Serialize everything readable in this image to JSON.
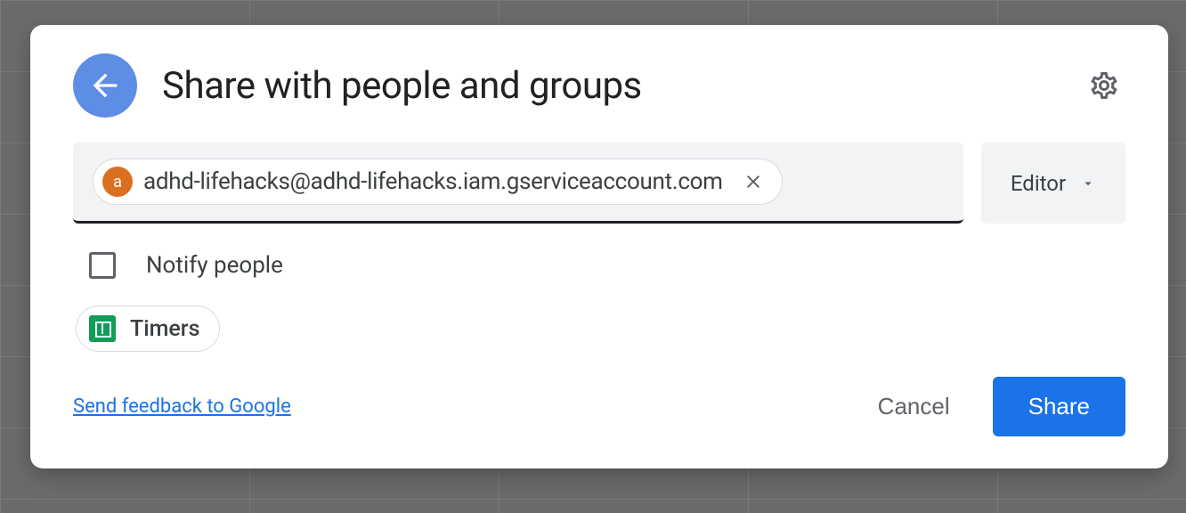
{
  "dialog": {
    "title": "Share with people and groups",
    "chip": {
      "avatar_letter": "a",
      "email": "adhd-lifehacks@adhd-lifehacks.iam.gserviceaccount.com"
    },
    "role": {
      "label": "Editor"
    },
    "notify": {
      "label": "Notify people",
      "checked": false
    },
    "file": {
      "name": "Timers"
    },
    "footer": {
      "feedback": "Send feedback to Google",
      "cancel": "Cancel",
      "share": "Share"
    }
  }
}
